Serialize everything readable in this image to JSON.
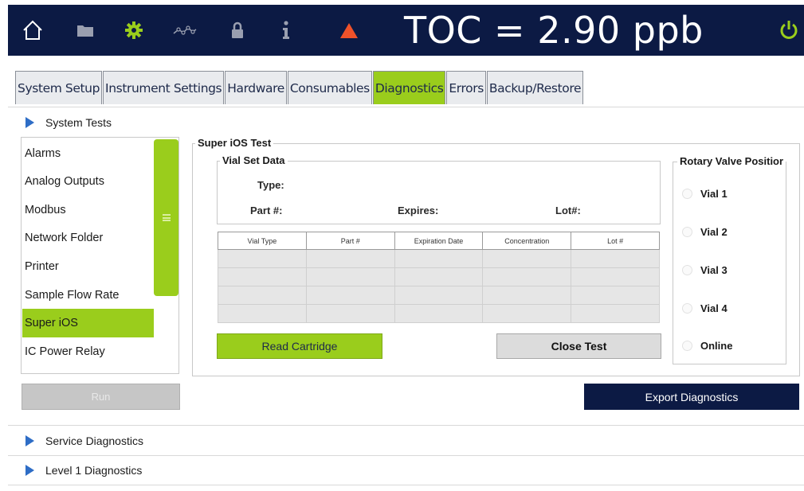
{
  "header": {
    "icons": [
      "home-icon",
      "folder-icon",
      "gear-icon",
      "trend-icon",
      "lock-icon",
      "info-icon",
      "warning-icon",
      "power-icon"
    ],
    "toc_reading": "TOC = 2.90 ppb",
    "colors": {
      "bar": "#0c1a44",
      "accent": "#9acd1c",
      "warning": "#f0522a"
    }
  },
  "tabs": [
    {
      "label": "System Setup",
      "active": false
    },
    {
      "label": "Instrument Settings",
      "active": false
    },
    {
      "label": "Hardware",
      "active": false
    },
    {
      "label": "Consumables",
      "active": false
    },
    {
      "label": "Diagnostics",
      "active": true
    },
    {
      "label": "Errors",
      "active": false
    },
    {
      "label": "Backup/Restore",
      "active": false
    }
  ],
  "sections": {
    "system_tests": "System Tests",
    "service_diagnostics": "Service Diagnostics",
    "level1_diagnostics": "Level 1 Diagnostics"
  },
  "test_list": {
    "items": [
      "Alarms",
      "Analog Outputs",
      "Modbus",
      "Network Folder",
      "Printer",
      "Sample Flow Rate",
      "Super iOS",
      "IC Power Relay"
    ],
    "selected": "Super iOS"
  },
  "run_button": "Run",
  "super_ios": {
    "title": "Super iOS Test",
    "vial_set": {
      "title": "Vial Set Data",
      "type_label": "Type:",
      "part_label": "Part #:",
      "expires_label": "Expires:",
      "lot_label": "Lot#:"
    },
    "table": {
      "columns": [
        "Vial Type",
        "Part #",
        "Expiration Date",
        "Concentration",
        "Lot #"
      ],
      "rows": [
        [
          "",
          "",
          "",
          "",
          ""
        ],
        [
          "",
          "",
          "",
          "",
          ""
        ],
        [
          "",
          "",
          "",
          "",
          ""
        ],
        [
          "",
          "",
          "",
          "",
          ""
        ]
      ]
    },
    "read_button": "Read Cartridge",
    "close_button": "Close Test"
  },
  "rotary_valve": {
    "title": "Rotary Valve Positior",
    "options": [
      "Vial 1",
      "Vial 2",
      "Vial 3",
      "Vial 4",
      "Online"
    ]
  },
  "export_button": "Export Diagnostics"
}
